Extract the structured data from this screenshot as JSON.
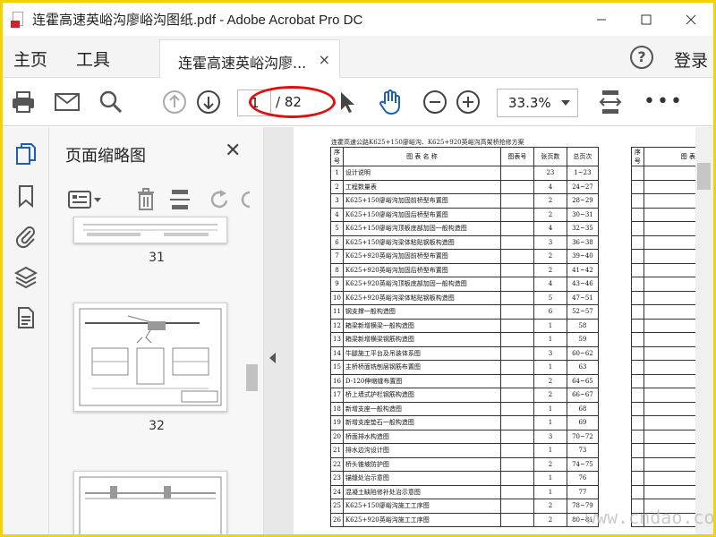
{
  "window": {
    "title": "连霍高速英峪沟廖峪沟图纸.pdf - Adobe Acrobat Pro DC",
    "controls": [
      "minimize",
      "maximize",
      "close"
    ]
  },
  "menubar": {
    "home": "主页",
    "tools": "工具",
    "tab_title": "连霍高速英峪沟廖...",
    "tab_close": "×",
    "help": "?",
    "login": "登录"
  },
  "toolbar": {
    "current_page": "1",
    "page_total": "/ 82",
    "zoom": "33.3%",
    "more": "•••"
  },
  "panel": {
    "title": "页面缩略图",
    "close": "✕",
    "thumbnails": [
      {
        "label": "31"
      },
      {
        "label": "32"
      }
    ]
  },
  "document": {
    "heading": "连霍高速公路K625+150廖峪沟、K625+920英峪沟高架桥抢修方案",
    "columns": [
      "序号",
      "图 表 名 称",
      "图表号",
      "张页数",
      "总页次"
    ],
    "right_columns": [
      "序号",
      "图 表"
    ],
    "rows": [
      {
        "no": "1",
        "name": "设计说明",
        "code": "",
        "pages": "23",
        "range": "1~23"
      },
      {
        "no": "2",
        "name": "工程数量表",
        "code": "",
        "pages": "4",
        "range": "24~27"
      },
      {
        "no": "3",
        "name": "K625+150廖峪沟加固前桥型布置图",
        "code": "",
        "pages": "2",
        "range": "28~29"
      },
      {
        "no": "4",
        "name": "K625+150廖峪沟加固后桥型布置图",
        "code": "",
        "pages": "2",
        "range": "30~31"
      },
      {
        "no": "5",
        "name": "K625+150廖峪沟顶板底部加固一般构造图",
        "code": "",
        "pages": "4",
        "range": "32~35"
      },
      {
        "no": "6",
        "name": "K625+150廖峪沟梁体粘贴钢板构造图",
        "code": "",
        "pages": "3",
        "range": "36~38"
      },
      {
        "no": "7",
        "name": "K625+920英峪沟加固前桥型布置图",
        "code": "",
        "pages": "2",
        "range": "39~40"
      },
      {
        "no": "8",
        "name": "K625+920英峪沟加固后桥型布置图",
        "code": "",
        "pages": "2",
        "range": "41~42"
      },
      {
        "no": "9",
        "name": "K625+920英峪沟顶板底部加固一般构造图",
        "code": "",
        "pages": "4",
        "range": "43~46"
      },
      {
        "no": "10",
        "name": "K625+920英峪沟梁体粘贴钢板构造图",
        "code": "",
        "pages": "5",
        "range": "47~51"
      },
      {
        "no": "11",
        "name": "钢支撑一般构造图",
        "code": "",
        "pages": "6",
        "range": "52~57"
      },
      {
        "no": "12",
        "name": "箱梁新增横梁一般构造图",
        "code": "",
        "pages": "1",
        "range": "58"
      },
      {
        "no": "13",
        "name": "箱梁新增横梁钢筋构造图",
        "code": "",
        "pages": "1",
        "range": "59"
      },
      {
        "no": "14",
        "name": "牛腿施工平台及吊装体系图",
        "code": "",
        "pages": "3",
        "range": "60~62"
      },
      {
        "no": "15",
        "name": "主桥桥面铣刨层钢筋布置图",
        "code": "",
        "pages": "1",
        "range": "63"
      },
      {
        "no": "16",
        "name": "D-120伸缩缝布置图",
        "code": "",
        "pages": "2",
        "range": "64~65"
      },
      {
        "no": "17",
        "name": "桥上墙式护栏钢筋构造图",
        "code": "",
        "pages": "2",
        "range": "66~67"
      },
      {
        "no": "18",
        "name": "新增支座一般构造图",
        "code": "",
        "pages": "1",
        "range": "68"
      },
      {
        "no": "19",
        "name": "新增支座垫石一般构造图",
        "code": "",
        "pages": "1",
        "range": "69"
      },
      {
        "no": "20",
        "name": "桥面排水构造图",
        "code": "",
        "pages": "3",
        "range": "70~72"
      },
      {
        "no": "21",
        "name": "排水边沟设计图",
        "code": "",
        "pages": "1",
        "range": "73"
      },
      {
        "no": "22",
        "name": "桥头锥坡防护图",
        "code": "",
        "pages": "2",
        "range": "74~75"
      },
      {
        "no": "23",
        "name": "锚缝处治示意图",
        "code": "",
        "pages": "1",
        "range": "76"
      },
      {
        "no": "24",
        "name": "混凝土缺陷修补处治示意图",
        "code": "",
        "pages": "1",
        "range": "77"
      },
      {
        "no": "25",
        "name": "K625+150廖峪沟施工工序图",
        "code": "",
        "pages": "2",
        "range": "78~79"
      },
      {
        "no": "26",
        "name": "K625+920英峪沟施工工序图",
        "code": "",
        "pages": "2",
        "range": "80~81"
      }
    ]
  },
  "watermark": "www.cndao.com",
  "colors": {
    "frame": "#f2d300",
    "annotation": "#e01010",
    "acrobat_red": "#d31f2c",
    "hand_tool": "#1a5fb4"
  },
  "icons": {
    "toolbar": [
      "print-icon",
      "email-icon",
      "search-icon",
      "page-up-icon",
      "page-down-icon",
      "select-cursor-icon",
      "hand-tool-icon",
      "zoom-out-icon",
      "zoom-in-icon",
      "fit-page-icon"
    ],
    "rail": [
      "thumbnails-icon",
      "bookmark-icon",
      "attachment-icon",
      "layers-icon",
      "page-content-icon"
    ]
  }
}
